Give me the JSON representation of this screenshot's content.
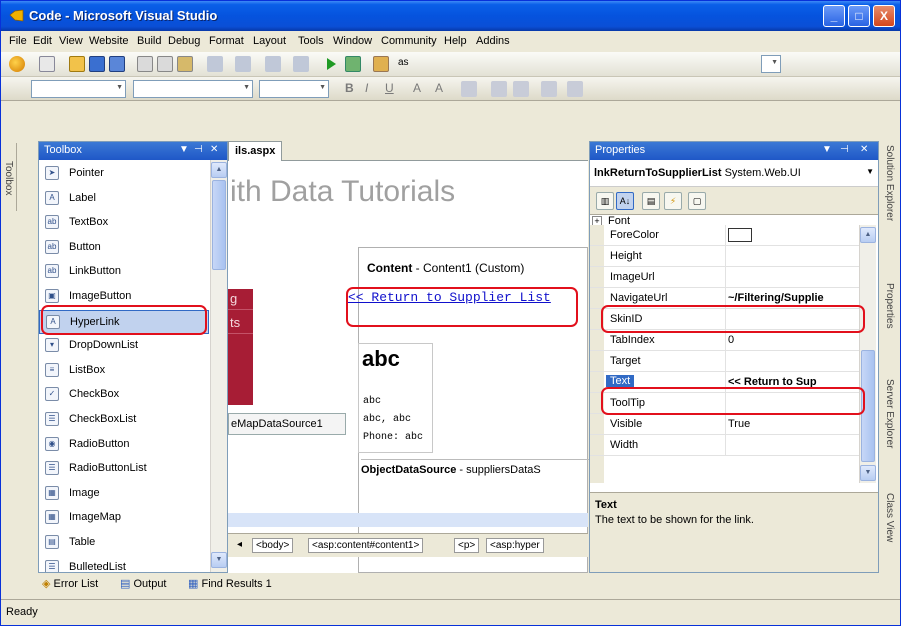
{
  "window": {
    "title": "Code - Microsoft Visual Studio",
    "minimize": "_",
    "restore": "□",
    "close": "X"
  },
  "menu": [
    "File",
    "Edit",
    "View",
    "Website",
    "Build",
    "Debug",
    "Format",
    "Layout",
    "Tools",
    "Window",
    "Community",
    "Help",
    "Addins"
  ],
  "toolbar": {
    "find_combo": "as",
    "format_buttons": [
      "B",
      "I",
      "U",
      "A",
      "A"
    ]
  },
  "left_side_tab": "Toolbox",
  "toolbox": {
    "title": "Toolbox",
    "items": [
      {
        "label": "Pointer",
        "icon": "pointer-icon",
        "glyph": "➤"
      },
      {
        "label": "Label",
        "icon": "label-icon",
        "glyph": "A"
      },
      {
        "label": "TextBox",
        "icon": "textbox-icon",
        "glyph": "ab"
      },
      {
        "label": "Button",
        "icon": "button-icon",
        "glyph": "ab"
      },
      {
        "label": "LinkButton",
        "icon": "linkbutton-icon",
        "glyph": "ab"
      },
      {
        "label": "ImageButton",
        "icon": "imagebutton-icon",
        "glyph": "▣"
      },
      {
        "label": "HyperLink",
        "icon": "hyperlink-icon",
        "glyph": "A"
      },
      {
        "label": "DropDownList",
        "icon": "dropdownlist-icon",
        "glyph": "▾"
      },
      {
        "label": "ListBox",
        "icon": "listbox-icon",
        "glyph": "≡"
      },
      {
        "label": "CheckBox",
        "icon": "checkbox-icon",
        "glyph": "✓"
      },
      {
        "label": "CheckBoxList",
        "icon": "checkboxlist-icon",
        "glyph": "☰"
      },
      {
        "label": "RadioButton",
        "icon": "radiobutton-icon",
        "glyph": "◉"
      },
      {
        "label": "RadioButtonList",
        "icon": "radiobuttonlist-icon",
        "glyph": "☰"
      },
      {
        "label": "Image",
        "icon": "image-icon",
        "glyph": "▦"
      },
      {
        "label": "ImageMap",
        "icon": "imagemap-icon",
        "glyph": "▦"
      },
      {
        "label": "Table",
        "icon": "table-icon",
        "glyph": "▤"
      },
      {
        "label": "BulletedList",
        "icon": "bulletedlist-icon",
        "glyph": "☰"
      }
    ],
    "selected_index": 6
  },
  "designer": {
    "tab_label": "ils.aspx",
    "heading": "ith Data Tutorials",
    "nav_letters": [
      "g",
      "ts"
    ],
    "content_name": "Content",
    "content_desc": " - Content1 (Custom)",
    "hyperlink_text": "<< Return to Supplier List",
    "abc_title": "abc",
    "abc_lines": [
      "abc",
      "abc, abc",
      "Phone: abc"
    ],
    "sitemap_label": "eMapDataSource1",
    "ods_name": "ObjectDataSource",
    "ods_desc": " - suppliersDataS",
    "breadcrumbs": [
      "<body>",
      "<asp:content#content1>",
      "<p>",
      "<asp:hyper"
    ]
  },
  "properties": {
    "title": "Properties",
    "object_name": "lnkReturnToSupplierList",
    "object_type": "System.Web.UI",
    "category": "Font",
    "rows": [
      {
        "name": "ForeColor",
        "value": ""
      },
      {
        "name": "Height",
        "value": ""
      },
      {
        "name": "ImageUrl",
        "value": ""
      },
      {
        "name": "NavigateUrl",
        "value": "~/Filtering/Supplie"
      },
      {
        "name": "SkinID",
        "value": ""
      },
      {
        "name": "TabIndex",
        "value": "0"
      },
      {
        "name": "Target",
        "value": ""
      },
      {
        "name": "Text",
        "value": "<< Return to Sup"
      },
      {
        "name": "ToolTip",
        "value": ""
      },
      {
        "name": "Visible",
        "value": "True"
      },
      {
        "name": "Width",
        "value": ""
      }
    ],
    "desc_title": "Text",
    "desc_body": "The text to be shown for the link."
  },
  "right_tabs": [
    "Solution Explorer",
    "Properties",
    "Server Explorer",
    "Class View"
  ],
  "bottom_tabs": [
    "Error List",
    "Output",
    "Find Results 1"
  ],
  "status": "Ready"
}
